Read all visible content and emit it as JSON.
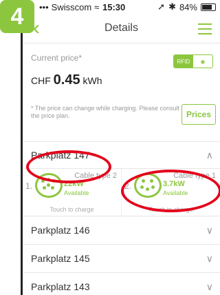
{
  "step": "4",
  "status": {
    "carrier": "Swisscom",
    "time": "15:30",
    "battery": "84%"
  },
  "nav": {
    "title": "Details"
  },
  "price": {
    "label": "Current price*",
    "currency": "CHF",
    "amount": "0.45",
    "unit": "kWh",
    "toggle_rfid": "RFID",
    "note": "* The price can change while charging. Please consult the price plan.",
    "prices_button": "Prices"
  },
  "stations": [
    {
      "name": "Parkplatz 147",
      "chargers": [
        {
          "index": "1.",
          "type": "Cable type 2",
          "power": "22kW",
          "status": "Available",
          "action": "Touch to charge"
        },
        {
          "index": "2.",
          "type": "Cable type 1",
          "power": "3.7kW",
          "status": "Available",
          "action": "Touch to charge"
        }
      ]
    },
    {
      "name": "Parkplatz 146"
    },
    {
      "name": "Parkplatz 145"
    },
    {
      "name": "Parkplatz 143"
    }
  ],
  "colors": {
    "accent": "#8cc63f",
    "highlight": "#e3001b"
  }
}
